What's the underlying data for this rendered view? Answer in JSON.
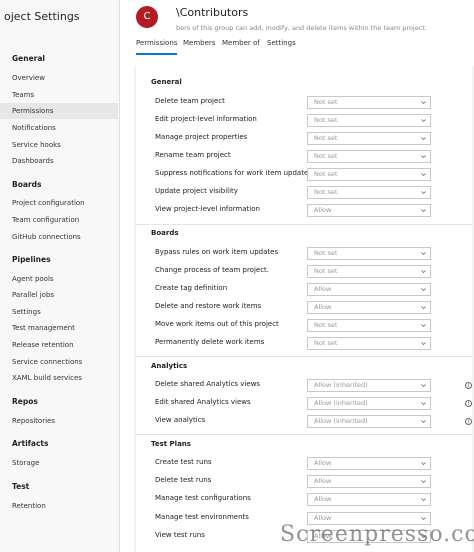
{
  "sidebar": {
    "title": "oject Settings",
    "sections": [
      {
        "label": "General",
        "items": [
          {
            "label": "Overview"
          },
          {
            "label": "Teams"
          },
          {
            "label": "Permissions",
            "active": true
          },
          {
            "label": "Notifications"
          },
          {
            "label": "Service hooks"
          },
          {
            "label": "Dashboards"
          }
        ]
      },
      {
        "label": "Boards",
        "items": [
          {
            "label": "Project configuration"
          },
          {
            "label": "Team configuration"
          },
          {
            "label": "GitHub connections"
          }
        ]
      },
      {
        "label": "Pipelines",
        "items": [
          {
            "label": "Agent pools"
          },
          {
            "label": "Parallel jobs"
          },
          {
            "label": "Settings"
          },
          {
            "label": "Test management"
          },
          {
            "label": "Release retention"
          },
          {
            "label": "Service connections"
          },
          {
            "label": "XAML build services"
          }
        ]
      },
      {
        "label": "Repos",
        "items": [
          {
            "label": "Repositories"
          }
        ]
      },
      {
        "label": "Artifacts",
        "items": [
          {
            "label": "Storage"
          }
        ]
      },
      {
        "label": "Test",
        "items": [
          {
            "label": "Retention"
          }
        ]
      }
    ]
  },
  "header": {
    "avatar_letter": "C",
    "group_name": "\\Contributors",
    "description": "bers of this group can add, modify, and delete items within the team project.",
    "tabs": [
      {
        "label": "Permissions",
        "active": true
      },
      {
        "label": "Members"
      },
      {
        "label": "Member of"
      },
      {
        "label": "Settings"
      }
    ]
  },
  "permissions": {
    "sections": [
      {
        "label": "General",
        "rows": [
          {
            "label": "Delete team project",
            "value": "Not set"
          },
          {
            "label": "Edit project-level information",
            "value": "Not set"
          },
          {
            "label": "Manage project properties",
            "value": "Not set"
          },
          {
            "label": "Rename team project",
            "value": "Not set"
          },
          {
            "label": "Suppress notifications for work item updates",
            "value": "Not set"
          },
          {
            "label": "Update project visibility",
            "value": "Not set"
          },
          {
            "label": "View project-level information",
            "value": "Allow"
          }
        ]
      },
      {
        "label": "Boards",
        "rows": [
          {
            "label": "Bypass rules on work item updates",
            "value": "Not set"
          },
          {
            "label": "Change process of team project.",
            "value": "Not set"
          },
          {
            "label": "Create tag definition",
            "value": "Allow"
          },
          {
            "label": "Delete and restore work items",
            "value": "Allow"
          },
          {
            "label": "Move work items out of this project",
            "value": "Not set"
          },
          {
            "label": "Permanently delete work items",
            "value": "Not set"
          }
        ]
      },
      {
        "label": "Analytics",
        "rows": [
          {
            "label": "Delete shared Analytics views",
            "value": "Allow (inherited)",
            "info": true
          },
          {
            "label": "Edit shared Analytics views",
            "value": "Allow (inherited)",
            "info": true
          },
          {
            "label": "View analytics",
            "value": "Allow (inherited)",
            "info": true
          }
        ]
      },
      {
        "label": "Test Plans",
        "rows": [
          {
            "label": "Create test runs",
            "value": "Allow"
          },
          {
            "label": "Delete test runs",
            "value": "Allow"
          },
          {
            "label": "Manage test configurations",
            "value": "Allow"
          },
          {
            "label": "Manage test environments",
            "value": "Allow"
          },
          {
            "label": "View test runs",
            "value": "Allow"
          }
        ]
      }
    ]
  },
  "watermark": "Screenpresso.co"
}
